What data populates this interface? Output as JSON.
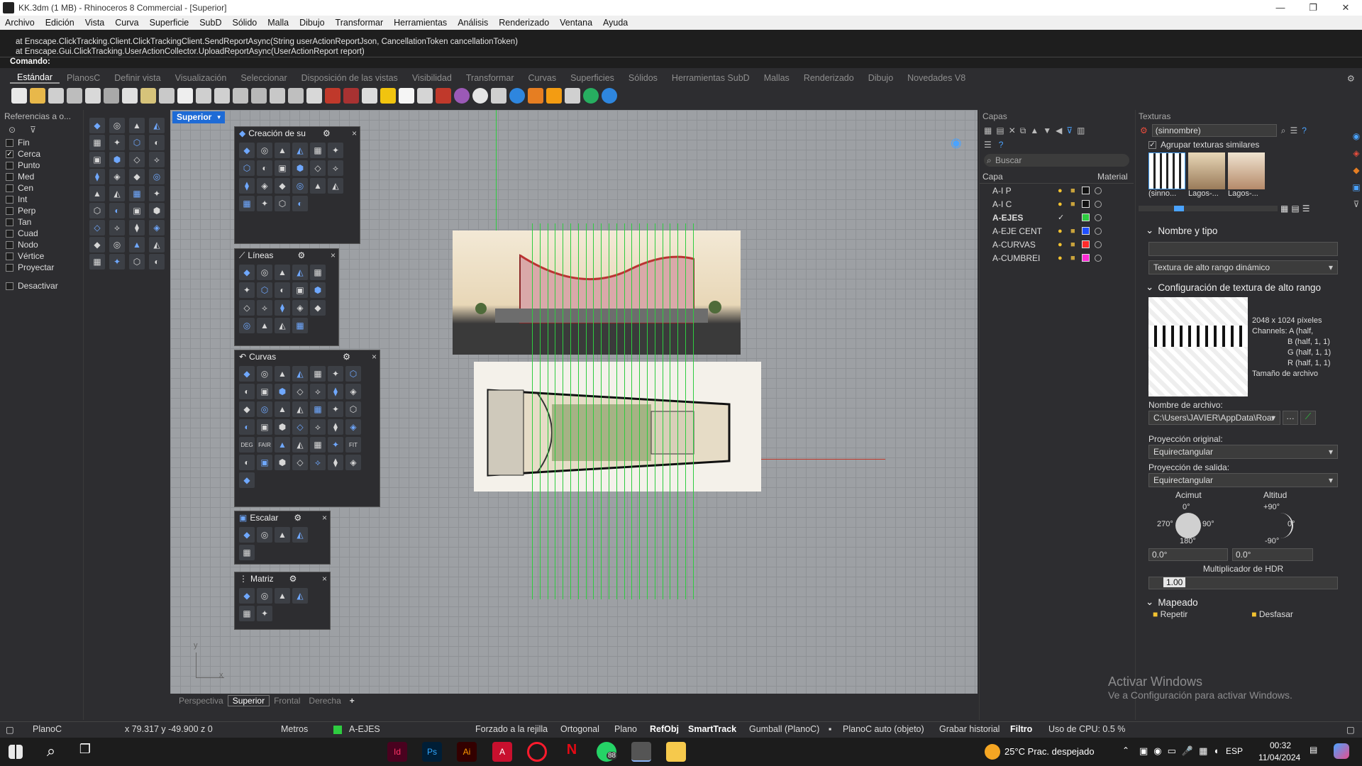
{
  "window": {
    "title": "KK.3dm (1 MB) - Rhinoceros 8 Commercial - [Superior]",
    "min": "—",
    "max": "❐",
    "close": "✕"
  },
  "menu": [
    "Archivo",
    "Edición",
    "Vista",
    "Curva",
    "Superficie",
    "SubD",
    "Sólido",
    "Malla",
    "Dibujo",
    "Transformar",
    "Herramientas",
    "Análisis",
    "Renderizado",
    "Ventana",
    "Ayuda"
  ],
  "command_history": [
    "at Enscape.ClickTracking.Client.ClickTrackingClient.SendReportAsync(String userActionReportJson, CancellationToken cancellationToken)",
    "at Enscape.Gui.ClickTracking.UserActionCollector.UploadReportAsync(UserActionReport report)"
  ],
  "command_prompt": "Comando:",
  "toolbar_tabs": [
    "Estándar",
    "PlanosC",
    "Definir vista",
    "Visualización",
    "Seleccionar",
    "Disposición de las vistas",
    "Visibilidad",
    "Transformar",
    "Curvas",
    "Superficies",
    "Sólidos",
    "Herramientas SubD",
    "Mallas",
    "Renderizado",
    "Dibujo",
    "Novedades V8"
  ],
  "osnap": {
    "title": "Referencias a o...",
    "items": [
      {
        "label": "Fin",
        "checked": false
      },
      {
        "label": "Cerca",
        "checked": true
      },
      {
        "label": "Punto",
        "checked": false
      },
      {
        "label": "Med",
        "checked": false
      },
      {
        "label": "Cen",
        "checked": false
      },
      {
        "label": "Int",
        "checked": false
      },
      {
        "label": "Perp",
        "checked": false
      },
      {
        "label": "Tan",
        "checked": false
      },
      {
        "label": "Cuad",
        "checked": false
      },
      {
        "label": "Nodo",
        "checked": false
      },
      {
        "label": "Vértice",
        "checked": false
      },
      {
        "label": "Proyectar",
        "checked": false
      }
    ],
    "disable": "Desactivar"
  },
  "viewport": {
    "name": "Superior",
    "tabs": [
      "Perspectiva",
      "Superior",
      "Frontal",
      "Derecha"
    ],
    "add": "+",
    "axis_y": "y",
    "axis_x": "x"
  },
  "panels": {
    "surface_creation": "Creación de su",
    "lines": "Líneas",
    "curves": "Curvas",
    "scale": "Escalar",
    "array": "Matriz",
    "close": "×"
  },
  "curve_tool_labels": {
    "deg": "DEG",
    "fair": "FAIR",
    "fit": "FIT"
  },
  "layers": {
    "title": "Capas",
    "search_placeholder": "Buscar",
    "col_layer": "Capa",
    "col_material": "Material",
    "rows": [
      {
        "name": "A-I P",
        "color": "#111111",
        "current": false
      },
      {
        "name": "A-I C",
        "color": "#111111",
        "current": false
      },
      {
        "name": "A-EJES",
        "color": "#2ecc40",
        "current": true
      },
      {
        "name": "A-EJE CENT",
        "color": "#1f4fff",
        "current": false
      },
      {
        "name": "A-CURVAS",
        "color": "#ff2a2a",
        "current": false
      },
      {
        "name": "A-CUMBREI",
        "color": "#ff2bd6",
        "current": false
      }
    ]
  },
  "textures": {
    "title": "Texturas",
    "current": "(sinnombre)",
    "group_similar": "Agrupar texturas similares",
    "thumbs": [
      "(sinno...",
      "Lagos-...",
      "Lagos-..."
    ],
    "name_type": "Nombre y tipo",
    "type_value": "Textura de alto rango dinámico",
    "hdr_config": "Configuración de textura de alto rango",
    "info": [
      "2048 x 1024 píxeles",
      "Channels: A (half,",
      "B (half, 1, 1)",
      "G (half, 1, 1)",
      "R (half, 1, 1)",
      "Tamaño de archivo"
    ],
    "filename_label": "Nombre de archivo:",
    "filename": "C:\\Users\\JAVIER\\AppData\\Roar",
    "proj_orig_label": "Proyección original:",
    "proj_orig": "Equirectangular",
    "proj_out_label": "Proyección de salida:",
    "proj_out": "Equirectangular",
    "azimuth": "Acimut",
    "altitude": "Altitud",
    "az_marks": {
      "top": "0°",
      "left": "270°",
      "right": "90°",
      "bottom": "180°"
    },
    "alt_marks": {
      "top": "+90°",
      "right": "0°",
      "bottom": "-90°"
    },
    "az_value": "0.0°",
    "alt_value": "0.0°",
    "hdr_mult": "Multiplicador de HDR",
    "hdr_value": "1.00",
    "mapping": "Mapeado",
    "repeat": "Repetir",
    "offset": "Desfasar"
  },
  "status": {
    "cplane": "PlanoC",
    "coords": "x 79.317  y -49.900  z 0",
    "units": "Metros",
    "layer": "A-EJES",
    "grid_snap": "Forzado a la rejilla",
    "ortho": "Ortogonal",
    "planar": "Plano",
    "osnap": "RefObj",
    "smarttrack": "SmartTrack",
    "gumball": "Gumball (PlanoC)",
    "autocplane": "PlanoC auto (objeto)",
    "history": "Grabar historial",
    "filter": "Filtro",
    "cpu": "Uso de CPU: 0.5 %"
  },
  "watermark": {
    "line1": "Activar Windows",
    "line2": "Ve a Configuración para activar Windows."
  },
  "taskbar": {
    "weather": "25°C  Prac. despejado",
    "lang": "ESP",
    "time": "00:32",
    "date": "11/04/2024",
    "whatsapp_badge": "88"
  }
}
